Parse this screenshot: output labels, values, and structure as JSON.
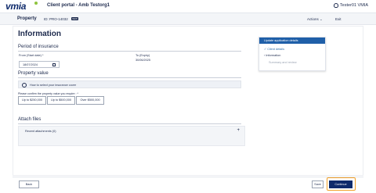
{
  "header": {
    "logo": "vmia",
    "title": "Client portal - Amb Testorg1",
    "user": "Tester01 VMIA"
  },
  "subheader": {
    "property": "Property",
    "id": "ID: PRO-14032",
    "badge": "NEW",
    "actions": "Actions",
    "exit": "Exit"
  },
  "form": {
    "heading": "Information",
    "period_section": "Period of insurance",
    "from_label": "From (Start date) *",
    "from_value": "18/07/2024",
    "to_label": "To (Expiry)",
    "to_value": "30/06/2025",
    "property_section": "Property value",
    "help_text": "How to select your insurance cover",
    "question": "Please confirm the property value you require : *",
    "options": [
      "Up to $250,000",
      "Up to $500,000",
      "Over $500,000"
    ],
    "attach_section": "Attach files",
    "recent_attachments": "Recent attachments (0)",
    "add_symbol": "+"
  },
  "nav": {
    "head": "Update application details",
    "items": [
      {
        "label": "Client details",
        "state": "done"
      },
      {
        "label": "Information",
        "state": "current"
      },
      {
        "label": "Summary and review",
        "state": "disabled"
      }
    ]
  },
  "footer": {
    "back": "Back",
    "save": "Save",
    "continue": "Continue"
  },
  "icons": [
    "user-icon",
    "calendar-icon",
    "help-icon",
    "check-icon",
    "chevron-right-icon",
    "chevron-down-icon"
  ],
  "colors": {
    "brand_navy": "#0e2a6b",
    "nav_header": "#1f5fa8",
    "highlight_orange": "#f2a027",
    "logo_green": "#8fc43e"
  }
}
